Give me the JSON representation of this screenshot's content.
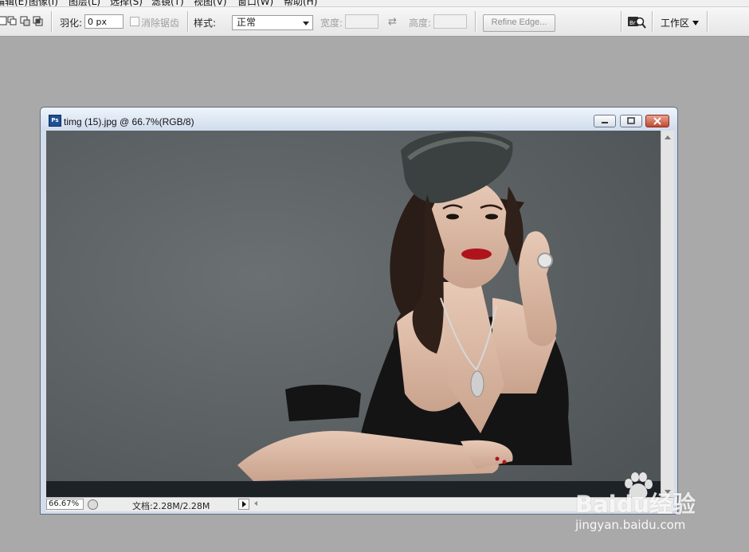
{
  "menu": {
    "items": [
      "编辑(E)",
      "图像(I)",
      "图层(L)",
      "选择(S)",
      "滤镜(T)",
      "视图(V)",
      "窗口(W)",
      "帮助(H)"
    ]
  },
  "options_bar": {
    "feather_label": "羽化:",
    "feather_value": "0 px",
    "antialias_label": "消除锯齿",
    "style_label": "样式:",
    "style_value": "正常",
    "width_label": "宽度:",
    "width_value": "",
    "height_label": "高度:",
    "height_value": "",
    "refine_edge_label": "Refine Edge...",
    "workspace_label": "工作区",
    "swap_icon": "⇄"
  },
  "document": {
    "title": "timg (15).jpg @ 66.7%(RGB/8)",
    "ps_icon_text": "Ps",
    "zoom": "66.67%",
    "doc_size": "文档:2.28M/2.28M"
  },
  "watermark": {
    "brand": "Baidu经验",
    "url": "jingyan.baidu.com"
  },
  "colors": {
    "app_background": "#a9a9a9",
    "canvas_backdrop": "#5e6366",
    "title_bar": "#d0dced",
    "close_button": "#c24a2f",
    "lipstick": "#b0141b"
  }
}
